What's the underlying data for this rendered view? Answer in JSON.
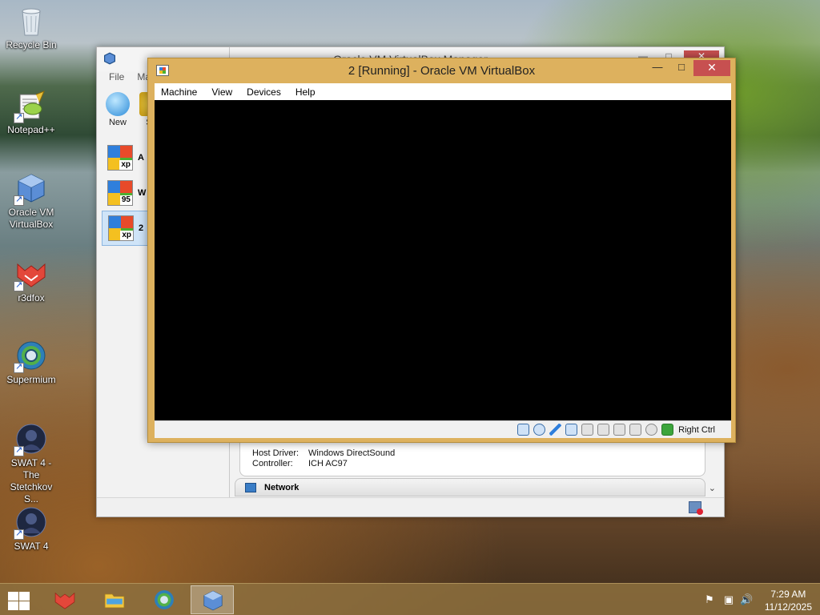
{
  "desktop": {
    "icons": [
      {
        "label": "Recycle Bin",
        "icon": "recycle-bin-icon"
      },
      {
        "label": "Notepad++",
        "icon": "notepad-plus-plus-icon"
      },
      {
        "label": "Oracle VM VirtualBox",
        "icon": "virtualbox-icon"
      },
      {
        "label": "r3dfox",
        "icon": "r3dfox-icon"
      },
      {
        "label": "Supermium",
        "icon": "supermium-icon"
      },
      {
        "label": "SWAT 4 - The Stetchkov S...",
        "icon": "swat4-expansion-icon"
      },
      {
        "label": "SWAT 4",
        "icon": "swat4-icon"
      }
    ]
  },
  "manager_window": {
    "title": "Oracle VM VirtualBox Manager",
    "menu": [
      "File",
      "Ma"
    ],
    "toolbar": [
      {
        "label": "New",
        "icon": "new-vm-icon"
      },
      {
        "label": "Se",
        "icon": "settings-gear-icon"
      }
    ],
    "vm_list": [
      {
        "name": "A",
        "os_badge": "xp",
        "selected": false
      },
      {
        "name": "W",
        "os_badge": "95",
        "selected": false
      },
      {
        "name": "2",
        "os_badge": "xp",
        "selected": true
      }
    ],
    "audio": {
      "host_driver_label": "Host Driver:",
      "host_driver_value": "Windows DirectSound",
      "controller_label": "Controller:",
      "controller_value": "ICH AC97"
    },
    "network_section": "Network"
  },
  "vm_window": {
    "title": "2 [Running] - Oracle VM VirtualBox",
    "menu": [
      "Machine",
      "View",
      "Devices",
      "Help"
    ],
    "status": {
      "host_key": "Right Ctrl",
      "indicators": [
        "hard-disk-icon",
        "optical-drive-icon",
        "floppy-pen-icon",
        "network-adapters-icon",
        "usb-icon",
        "shared-folders-icon",
        "display-icon",
        "video-capture-icon",
        "mouse-integration-icon",
        "keyboard-capture-icon"
      ]
    }
  },
  "taskbar": {
    "apps": [
      "r3dfox-icon",
      "file-explorer-icon",
      "supermium-icon",
      "virtualbox-icon"
    ],
    "active_app": "virtualbox-icon",
    "time": "7:29 AM",
    "date": "11/12/2025"
  }
}
